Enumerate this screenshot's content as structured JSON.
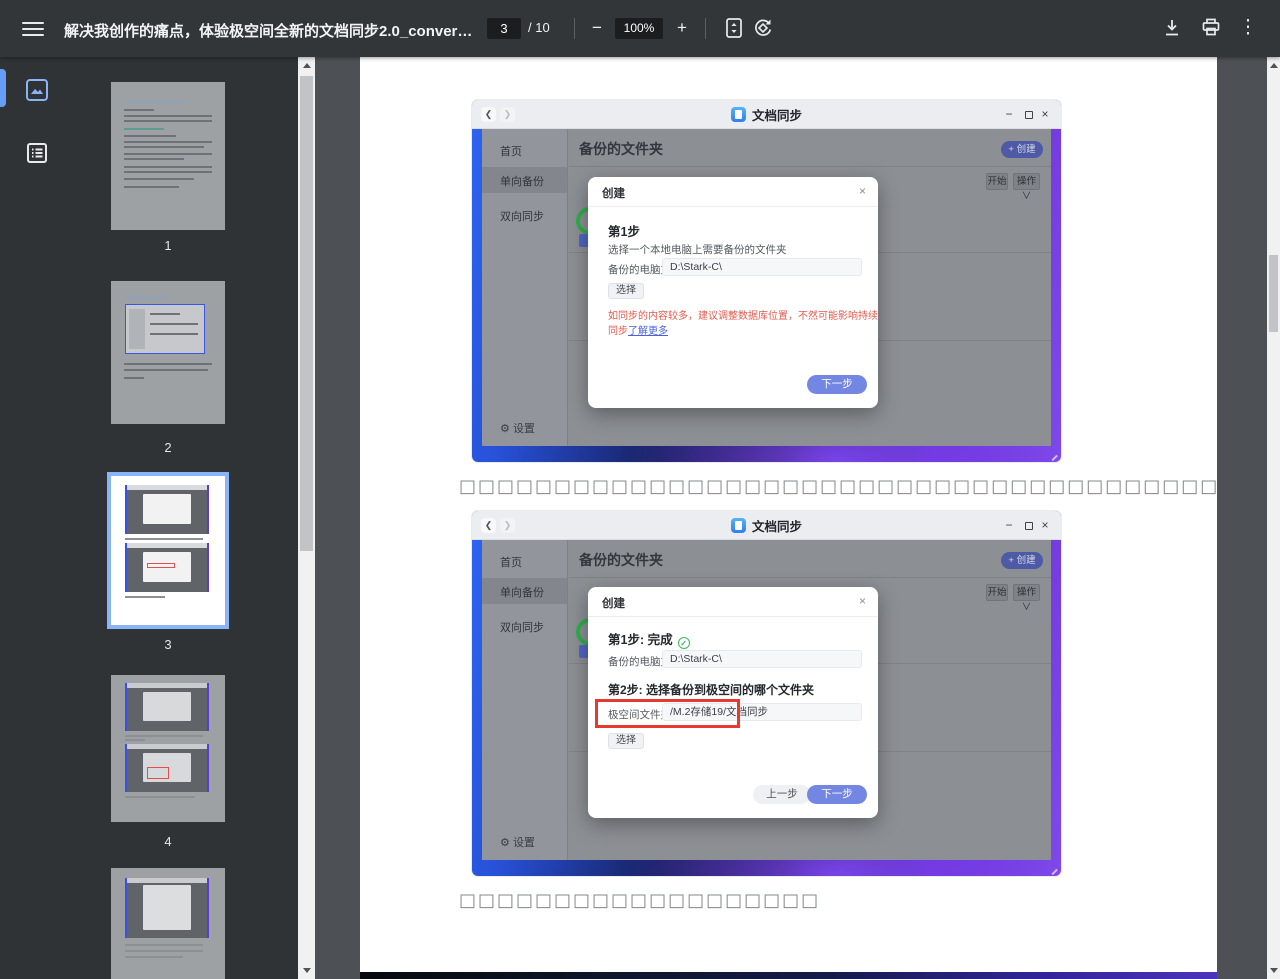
{
  "toolbar": {
    "title": "解决我创作的痛点，体验极空间全新的文档同步2.0_converte...",
    "page_current": "3",
    "page_total": "/ 10",
    "zoom_out": "−",
    "zoom_level": "100%",
    "zoom_in": "+",
    "more_icon": "⋮"
  },
  "sidebar": {
    "thumbnails": [
      {
        "label": "1"
      },
      {
        "label": "2"
      },
      {
        "label": "3"
      },
      {
        "label": "4"
      },
      {
        "label": ""
      }
    ]
  },
  "page": {
    "caption1": "□□□□□□□□□□□□□□□□□□□□□□□□□□□□□□□□□□□□□□□□",
    "caption2": "□□□□□□□□□□□□□□□□□□□"
  },
  "app": {
    "window_title": "文档同步",
    "back": "❮",
    "forward": "❯",
    "minimize": "−",
    "close": "×",
    "nav": {
      "home": "首页",
      "one_way": "单向备份",
      "two_way": "双向同步"
    },
    "settings_icon": "⚙",
    "settings": "设置",
    "heading": "备份的文件夹",
    "create_button": "+ 创建",
    "start_button": "开始",
    "action_button": "操作",
    "action_caret": "∨"
  },
  "dialog1": {
    "title": "创建",
    "close": "×",
    "step1": "第1步",
    "desc": "选择一个本地电脑上需要备份的文件夹",
    "field_label": "备份的电脑文件夹",
    "field_value": "D:\\Stark-C\\",
    "choose": "选择",
    "warning": "如同步的内容较多，建议调整数据库位置，不然可能影响持续同步",
    "link": "了解更多",
    "next": "下一步"
  },
  "dialog2": {
    "title": "创建",
    "close": "×",
    "step1_done": "第1步: 完成",
    "check": "✓",
    "field_label": "备份的电脑文件夹",
    "field_value": "D:\\Stark-C\\",
    "step2": "第2步: 选择备份到极空间的哪个文件夹",
    "field2_label": "极空间文件夹",
    "field2_value": "/M.2存储19/文档同步",
    "choose": "选择",
    "prev": "上一步",
    "next": "下一步"
  },
  "colors": {
    "accent_blue": "#7286e2",
    "create_button_blue": "#4e5aa5",
    "annotation_red": "#e8392e",
    "warning_red": "#e25a4e",
    "link_blue": "#4a63dd",
    "success_green": "#3cb85c",
    "selected_thumb_border": "#8ab4f8",
    "toolbar_bg": "#323639",
    "viewer_bg": "#4d5155"
  }
}
